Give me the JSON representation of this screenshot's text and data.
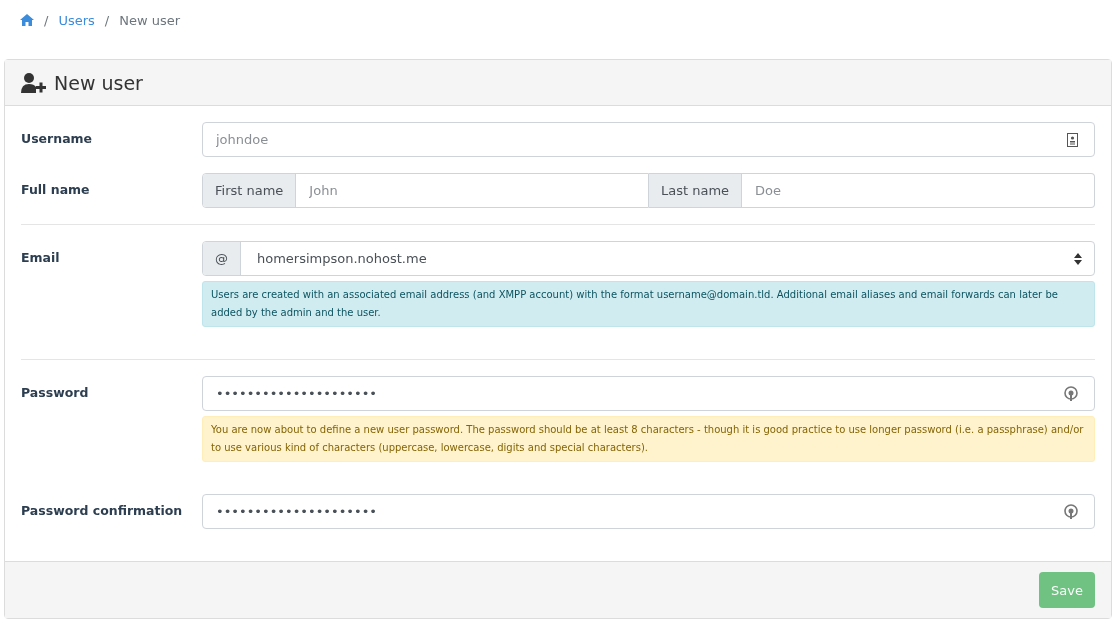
{
  "breadcrumb_separator": "/",
  "breadcrumb": [
    {
      "kind": "home"
    },
    {
      "kind": "link",
      "label": "Users"
    },
    {
      "kind": "current",
      "label": "New user"
    }
  ],
  "card": {
    "title": "New user"
  },
  "username": {
    "label": "Username",
    "placeholder": "johndoe"
  },
  "fullname": {
    "label": "Full name",
    "first_addon": "First name",
    "first_placeholder": "John",
    "last_addon": "Last name",
    "last_placeholder": "Doe"
  },
  "email": {
    "label": "Email",
    "addon": "@",
    "value": "homersimpson.nohost.me",
    "help": "Users are created with an associated email address (and XMPP account) with the format username@domain.tld. Additional email aliases and email forwards can later be added by the admin and the user."
  },
  "password": {
    "label": "Password",
    "value": "•••••••••••••••••••••",
    "help": "You are now about to define a new user password. The password should be at least 8 characters - though it is good practice to use longer password (i.e. a passphrase) and/or to use various kind of characters (uppercase, lowercase, digits and special characters)."
  },
  "password_confirmation": {
    "label": "Password confirmation",
    "value": "•••••••••••••••••••••"
  },
  "save_button": {
    "label": "Save",
    "disabled": true
  }
}
